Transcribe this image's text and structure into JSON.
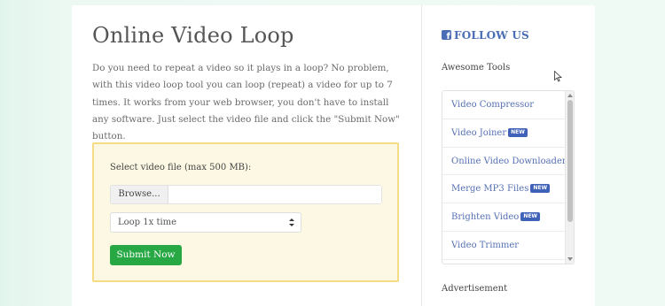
{
  "main": {
    "title": "Online Video Loop",
    "intro": "Do you need to repeat a video so it plays in a loop? No problem, with this video loop tool you can loop (repeat) a video for up to 7 times. It works from your web browser, you don't have to install any software. Just select the video file and click the \"Submit Now\" button.",
    "upload_label": "Select video file (max 500 MB):",
    "browse_label": "Browse...",
    "file_value": "",
    "loop_select_value": "Loop 1x time",
    "submit_label": "Submit Now"
  },
  "sidebar": {
    "follow_label": "FOLLOW US",
    "follow_icon": "facebook-icon",
    "tools_heading": "Awesome Tools",
    "tools": [
      {
        "label": "Video Compressor",
        "badge": ""
      },
      {
        "label": "Video Joiner",
        "badge": "NEW"
      },
      {
        "label": "Online Video Downloader",
        "badge": ""
      },
      {
        "label": "Merge MP3 Files",
        "badge": "NEW"
      },
      {
        "label": "Brighten Video",
        "badge": "NEW"
      },
      {
        "label": "Video Trimmer",
        "badge": ""
      }
    ],
    "advert_label": "Advertisement"
  },
  "colors": {
    "accent": "#4a6db6",
    "submit": "#27a844",
    "upload_bg": "#fcf8e3",
    "upload_border": "#f7dc88"
  }
}
